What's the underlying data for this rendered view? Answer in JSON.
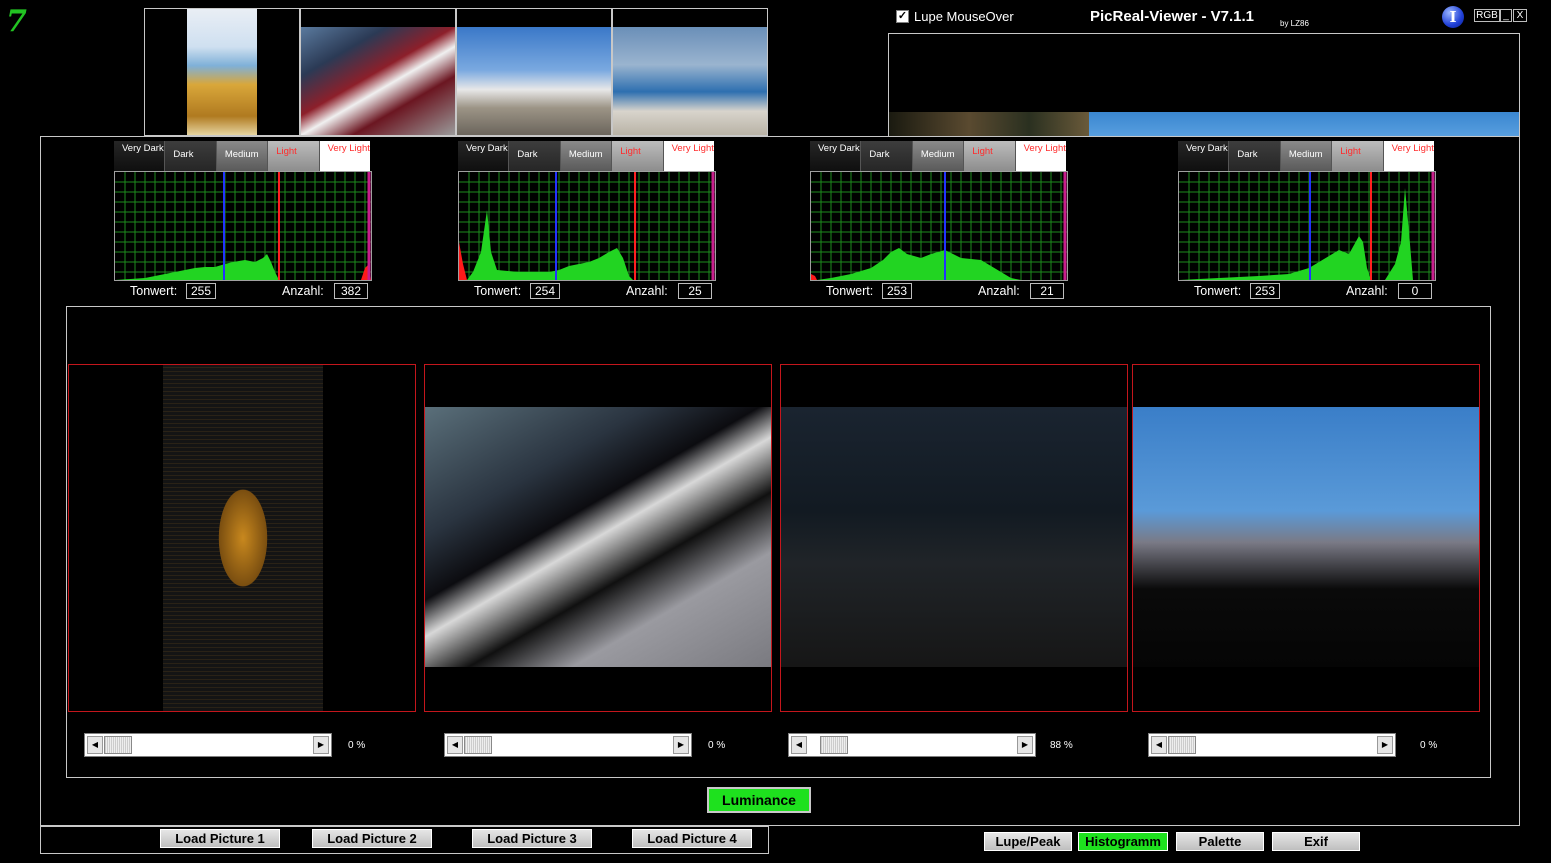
{
  "titlebar": {
    "title": "PicReal-Viewer - V7.1.1",
    "byline": "by LZ86",
    "lupe_mouseover_label": "Lupe MouseOver",
    "lupe_mouseover_checked": true,
    "rgb_label": "RGB",
    "minimize_label": "_",
    "close_label": "X",
    "info_icon": "info-icon",
    "logo_text": "7"
  },
  "histograms": [
    {
      "tones": [
        "Very Dark",
        "Dark",
        "Medium",
        "Light",
        "Very Light"
      ],
      "tonwert_label": "Tonwert:",
      "tonwert": "255",
      "anzahl_label": "Anzahl:",
      "anzahl": "382"
    },
    {
      "tones": [
        "Very Dark",
        "Dark",
        "Medium",
        "Light",
        "Very Light"
      ],
      "tonwert_label": "Tonwert:",
      "tonwert": "254",
      "anzahl_label": "Anzahl:",
      "anzahl": "25"
    },
    {
      "tones": [
        "Very Dark",
        "Dark",
        "Medium",
        "Light",
        "Very Light"
      ],
      "tonwert_label": "Tonwert:",
      "tonwert": "253",
      "anzahl_label": "Anzahl:",
      "anzahl": "21"
    },
    {
      "tones": [
        "Very Dark",
        "Dark",
        "Medium",
        "Light",
        "Very Light"
      ],
      "tonwert_label": "Tonwert:",
      "tonwert": "253",
      "anzahl_label": "Anzahl:",
      "anzahl": "0"
    }
  ],
  "sliders": [
    {
      "value_percent": 0,
      "label": "0 %"
    },
    {
      "value_percent": 0,
      "label": "0 %"
    },
    {
      "value_percent": 88,
      "label": "88 %"
    },
    {
      "value_percent": 0,
      "label": "0 %"
    }
  ],
  "luminance_label": "Luminance",
  "load_buttons": [
    "Load Picture 1",
    "Load Picture 2",
    "Load Picture 3",
    "Load Picture 4"
  ],
  "view_buttons": [
    {
      "label": "Lupe/Peak",
      "active": false
    },
    {
      "label": "Histogramm",
      "active": true
    },
    {
      "label": "Palette",
      "active": false
    },
    {
      "label": "Exif",
      "active": false
    }
  ],
  "colors": {
    "accent_green": "#1ee11e",
    "tile_border": "#c4161c",
    "histogram_grid": "#1e8a1e",
    "histogram_fill": "#22d422"
  }
}
